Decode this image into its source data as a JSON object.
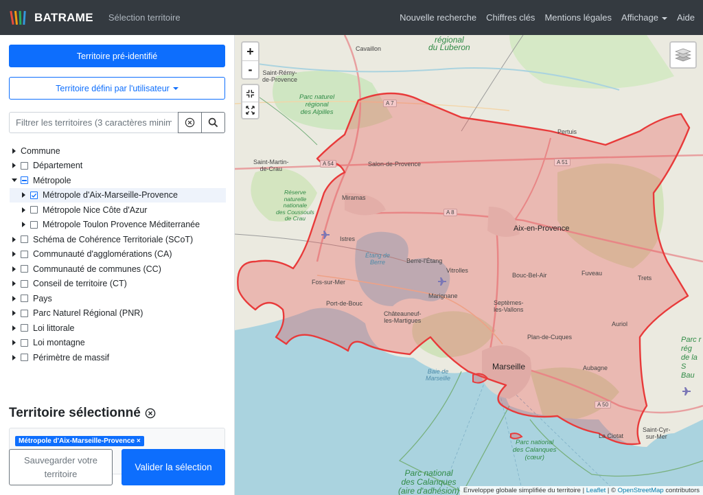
{
  "navbar": {
    "brand": "BATRAME",
    "subtitle": "Sélection territoire",
    "links": [
      "Nouvelle recherche",
      "Chiffres clés",
      "Mentions légales",
      "Affichage",
      "Aide"
    ]
  },
  "sidebar": {
    "btn_preidentified": "Territoire pré-identifié",
    "btn_user_defined": "Territoire défini par l'utilisateur",
    "filter_placeholder": "Filtrer les territoires (3 caractères minimum)",
    "tree": {
      "commune": "Commune",
      "departement": "Département",
      "metropole": "Métropole",
      "metro_items": [
        "Métropole d'Aix-Marseille-Provence",
        "Métropole Nice Côte d'Azur",
        "Métropole Toulon Provence Méditerranée"
      ],
      "scot": "Schéma de Cohérence Territoriale (SCoT)",
      "ca": "Communauté d'agglomérations (CA)",
      "cc": "Communauté de communes (CC)",
      "ct": "Conseil de territoire (CT)",
      "pays": "Pays",
      "pnr": "Parc Naturel Régional (PNR)",
      "littorale": "Loi littorale",
      "montagne": "Loi montagne",
      "massif": "Périmètre de massif"
    },
    "selected_title": "Territoire sélectionné",
    "selected_tag": "Métropole d'Aix-Marseille-Provence ×",
    "btn_save": "Sauvegarder votre territoire",
    "btn_validate": "Valider la sélection"
  },
  "map": {
    "zoom_in": "+",
    "zoom_out": "-",
    "labels": {
      "cavaillon": "Cavaillon",
      "st_remy": "Saint-Rémy-\nde-Provence",
      "pnr_luberon": "régional\ndu Luberon",
      "pnr_alpilles": "Parc naturel\nrégional\ndes Alpilles",
      "st_martin": "Saint-Martin-\nde-Crau",
      "salon": "Salon-de-Provence",
      "pertuis": "Pertuis",
      "reserve": "Réserve\nnaturelle\nnationale\ndes Coussouls\nde Crau",
      "miramas": "Miramas",
      "aix": "Aix-en-Provence",
      "istres": "Istres",
      "etang": "Étang de\nBerre",
      "berre": "Berre-l'Étang",
      "vitrolles": "Vitrolles",
      "bouc_bel_air": "Bouc-Bel-Air",
      "fuveau": "Fuveau",
      "trets": "Trets",
      "fos": "Fos-sur-Mer",
      "port_de_bouc": "Port-de-Bouc",
      "marignane": "Marignane",
      "septemes": "Septèmes-\nles-Vallons",
      "chateauneuf": "Châteauneuf-\nles-Martigues",
      "auriol": "Auriol",
      "plan_de_cuques": "Plan-de-Cuques",
      "marseille": "Marseille",
      "baie": "Baie de\nMarseille",
      "aubagne": "Aubagne",
      "calanques_coeur": "Parc national\ndes Calanques\n(cœur)",
      "calanques_adh": "Parc national\ndes Calanques\n(aire d'adhésion)",
      "la_ciotat": "La Ciotat",
      "st_cyr": "Saint-Cyr-\nsur-Mer",
      "parc_right": "Parc r\nrég\nde la S\nBau",
      "a7": "A 7",
      "a54": "A 54",
      "a51": "A 51",
      "a8": "A 8",
      "a50": "A 50"
    },
    "attribution_prefix": "Enveloppe globale simplifiée du territoire | ",
    "attribution_leaflet": "Leaflet",
    "attribution_sep": " | © ",
    "attribution_osm": "OpenStreetMap",
    "attribution_suffix": " contributors"
  }
}
